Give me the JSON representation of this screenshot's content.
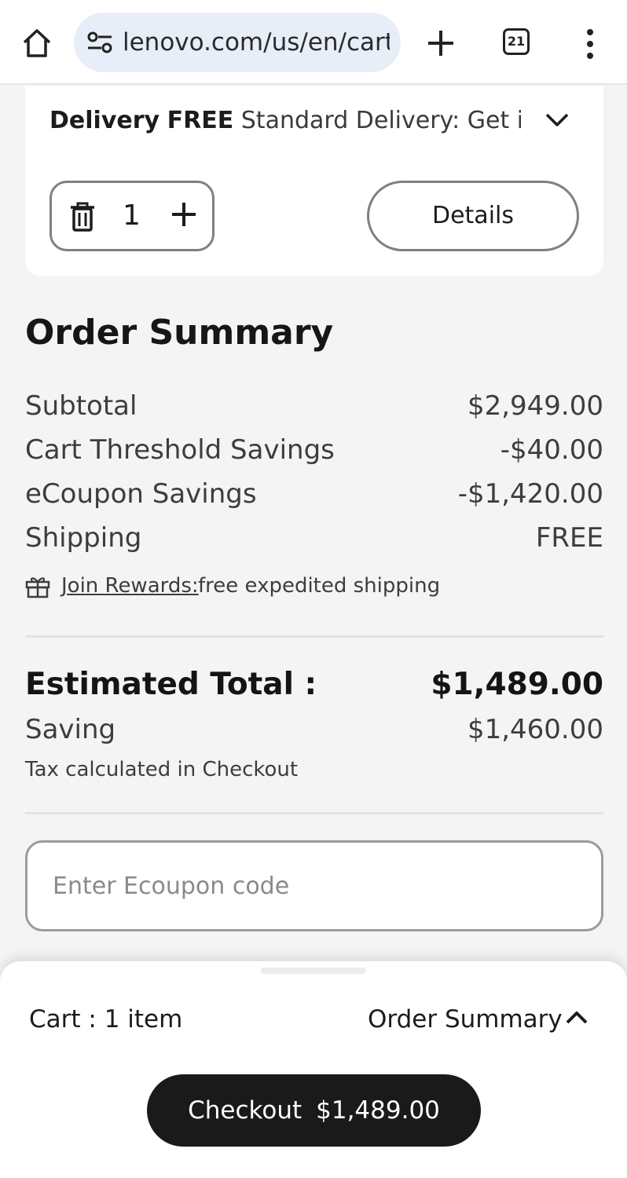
{
  "browser": {
    "url": "lenovo.com/us/en/cart",
    "tab_count": "21",
    "icons": [
      "home-icon",
      "site-settings-icon",
      "new-tab-icon",
      "tabs-icon",
      "menu-icon"
    ]
  },
  "cart_item": {
    "delivery_label": "Delivery",
    "delivery_price": "FREE",
    "delivery_text": "Standard Delivery: Get it ...",
    "quantity": "1",
    "details_label": "Details"
  },
  "order_summary": {
    "title": "Order Summary",
    "lines": [
      {
        "label": "Subtotal",
        "value": "$2,949.00"
      },
      {
        "label": "Cart Threshold Savings",
        "value": "-$40.00"
      },
      {
        "label": "eCoupon Savings",
        "value": "-$1,420.00"
      },
      {
        "label": "Shipping",
        "value": "FREE"
      }
    ],
    "rewards_link": "Join Rewards:",
    "rewards_text": " free expedited shipping",
    "estimated_total_label": "Estimated Total :",
    "estimated_total_value": "$1,489.00",
    "saving_label": "Saving",
    "saving_value": "$1,460.00",
    "tax_note": "Tax calculated in Checkout",
    "coupon_placeholder": "Enter Ecoupon code",
    "coupon_value": ""
  },
  "bottom_sheet": {
    "cart_count": "Cart : 1 item",
    "summary_toggle": "Order Summary",
    "checkout_label": "Checkout",
    "checkout_total": "$1,489.00"
  }
}
